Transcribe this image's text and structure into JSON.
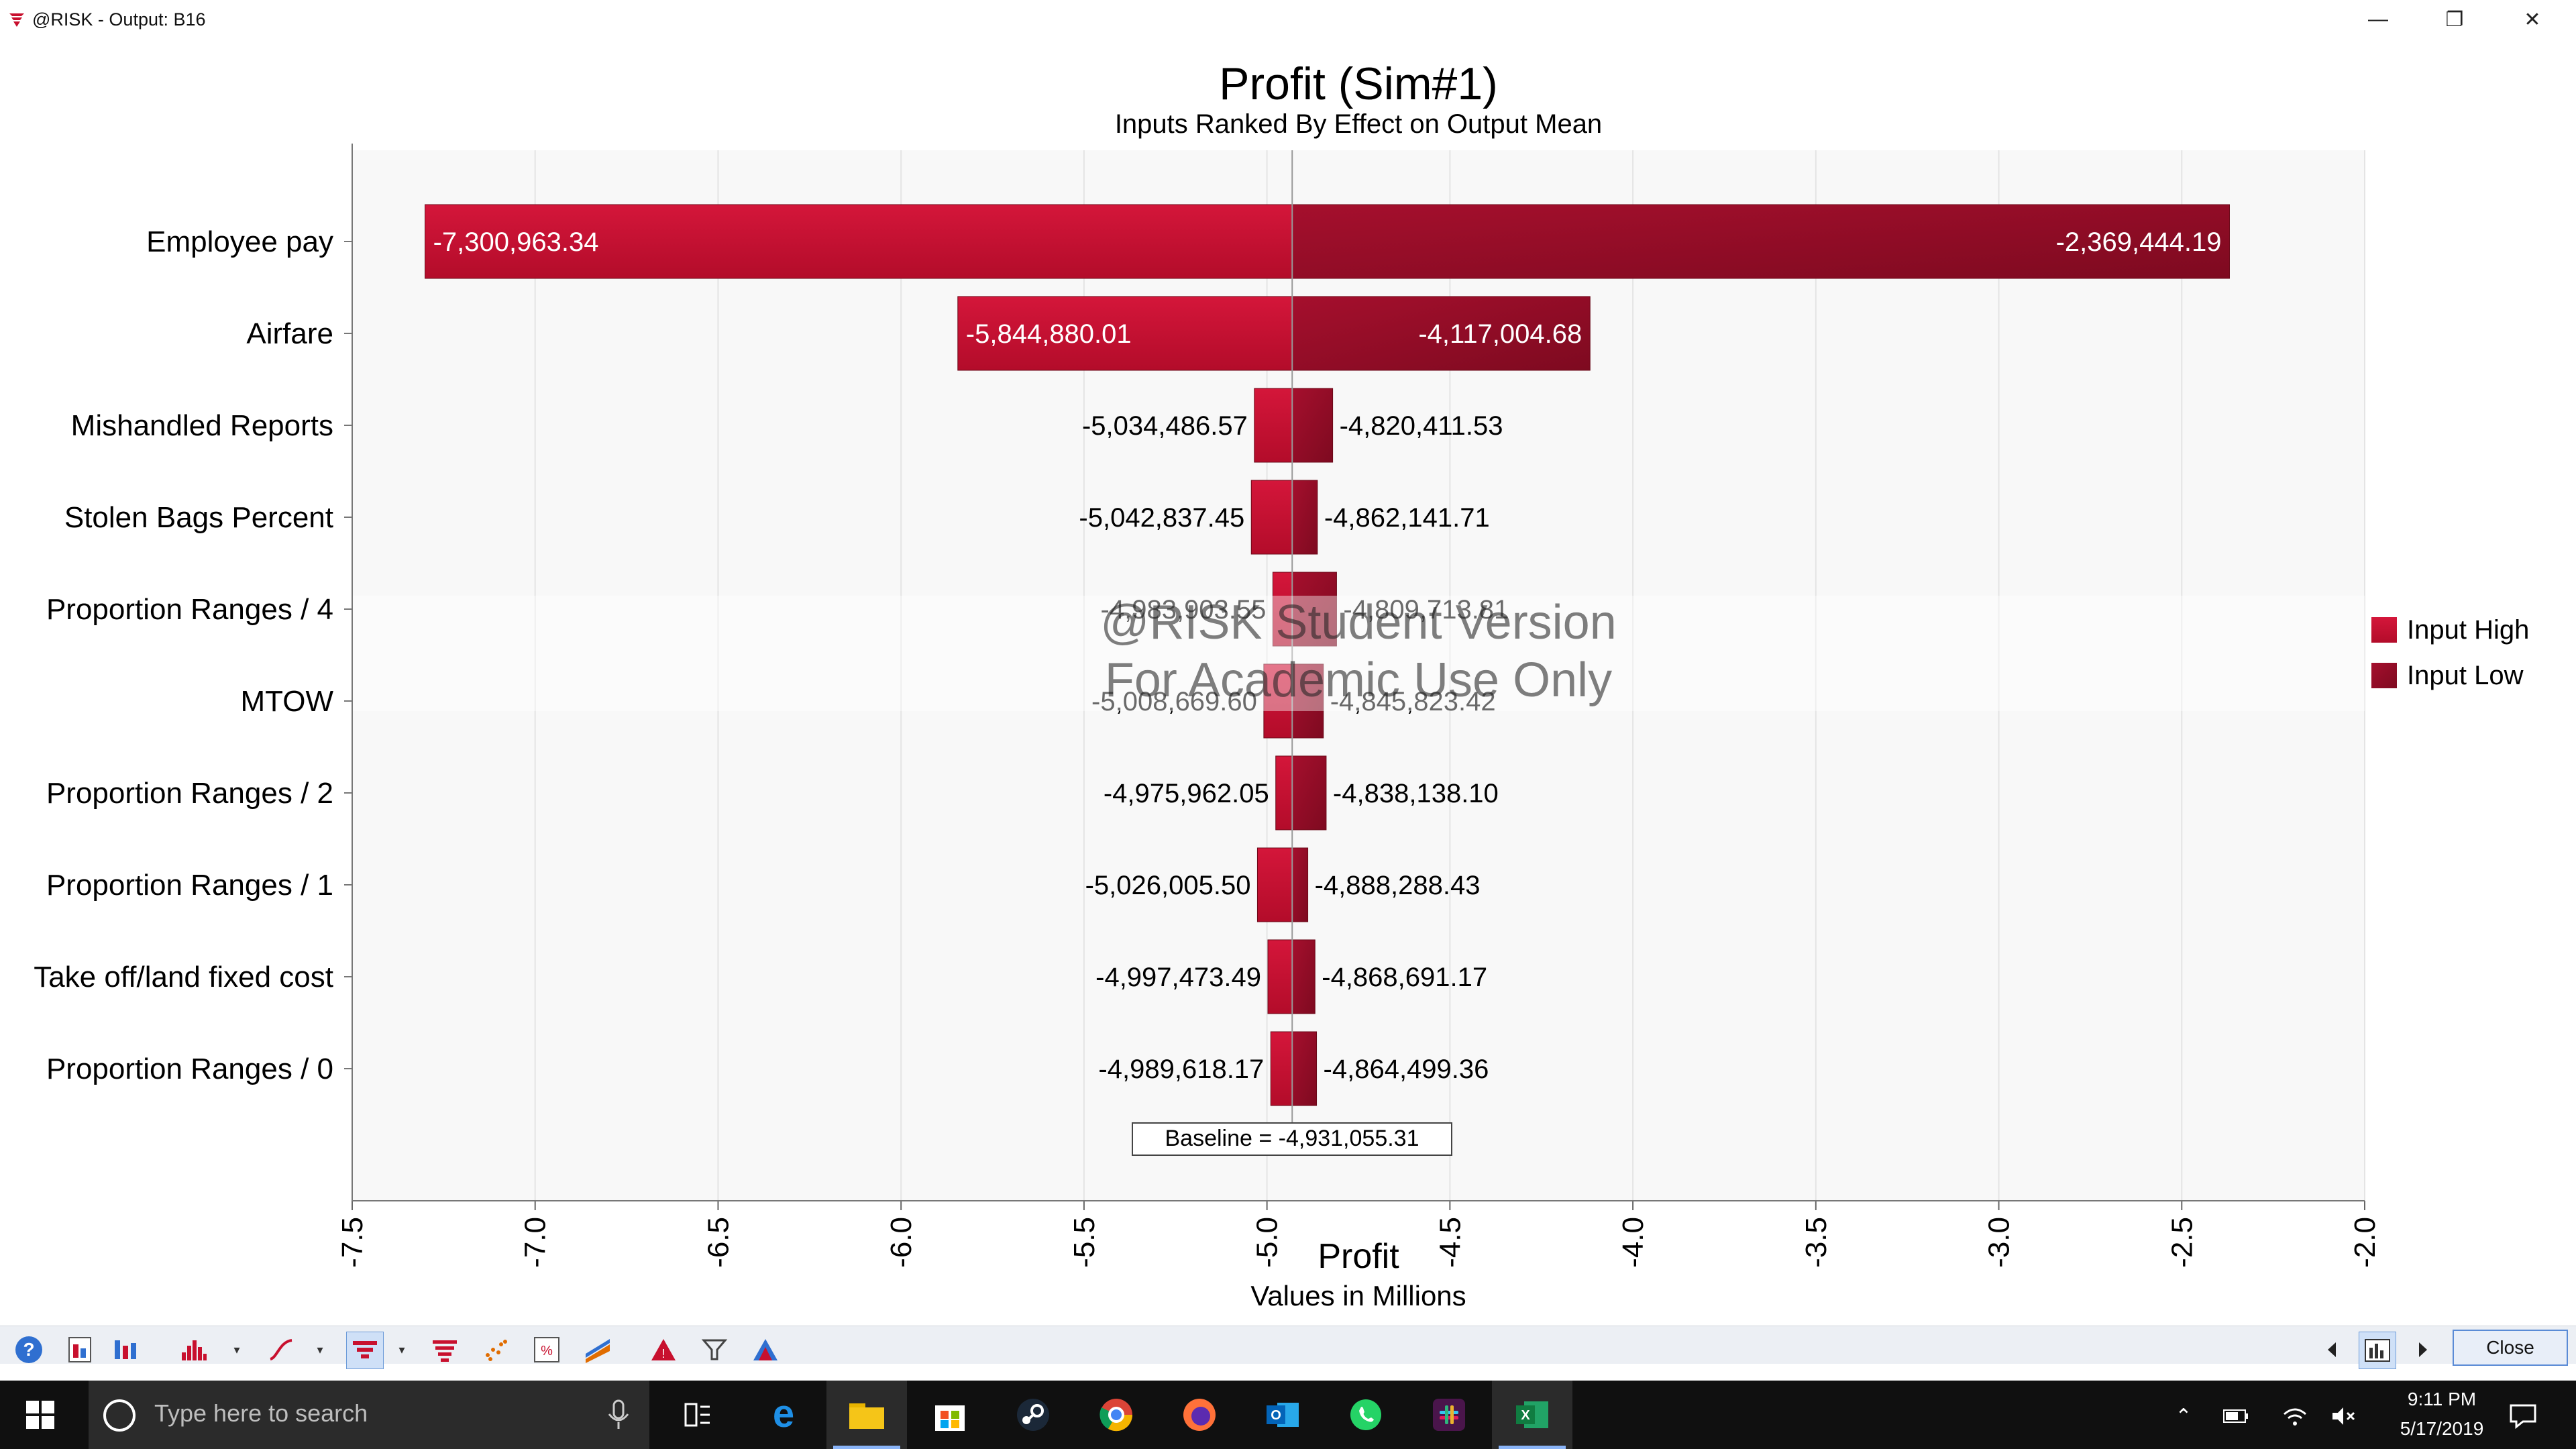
{
  "window": {
    "title": "@RISK - Output: B16",
    "min_glyph": "—",
    "max_glyph": "❐",
    "close_glyph": "✕"
  },
  "colors": {
    "bar_high": "#c8102e",
    "bar_low": "#8e0b24",
    "grid": "#e6e6e6",
    "plot_bg": "#f8f8f8"
  },
  "chart_data": {
    "type": "bar",
    "orientation": "horizontal-tornado",
    "title": "Profit (Sim#1)",
    "subtitle": "Inputs Ranked By Effect on Output Mean",
    "xlabel": "Profit",
    "xlabel_units": "Values in Millions",
    "xlim": [
      -7.5,
      -2.0
    ],
    "xticks": [
      "-7.5",
      "-7.0",
      "-6.5",
      "-6.0",
      "-5.5",
      "-5.0",
      "-4.5",
      "-4.0",
      "-3.5",
      "-3.0",
      "-2.5",
      "-2.0"
    ],
    "baseline_value": -4.93105531,
    "baseline_label": "Baseline = -4,931,055.31",
    "legend": [
      "Input High",
      "Input Low"
    ],
    "legend_position": "right",
    "grid": true,
    "bars": [
      {
        "label": "Employee pay",
        "low_value": -7.30096334,
        "high_value": -2.36944419,
        "low_label": "-7,300,963.34",
        "high_label": "-2,369,444.19"
      },
      {
        "label": "Airfare",
        "low_value": -5.84488001,
        "high_value": -4.11700468,
        "low_label": "-5,844,880.01",
        "high_label": "-4,117,004.68"
      },
      {
        "label": "Mishandled Reports",
        "low_value": -5.03448657,
        "high_value": -4.82041153,
        "low_label": "-5,034,486.57",
        "high_label": "-4,820,411.53"
      },
      {
        "label": "Stolen Bags Percent",
        "low_value": -5.04283745,
        "high_value": -4.86214171,
        "low_label": "-5,042,837.45",
        "high_label": "-4,862,141.71"
      },
      {
        "label": "Proportion Ranges / 4",
        "low_value": -4.98390355,
        "high_value": -4.80971381,
        "low_label": "-4,983,903.55",
        "high_label": "-4,809,713.81"
      },
      {
        "label": "MTOW",
        "low_value": -5.0086696,
        "high_value": -4.84582342,
        "low_label": "-5,008,669.60",
        "high_label": "-4,845,823.42"
      },
      {
        "label": "Proportion Ranges / 2",
        "low_value": -4.97596205,
        "high_value": -4.8381381,
        "low_label": "-4,975,962.05",
        "high_label": "-4,838,138.10"
      },
      {
        "label": "Proportion Ranges / 1",
        "low_value": -5.0260055,
        "high_value": -4.88828843,
        "low_label": "-5,026,005.50",
        "high_label": "-4,888,288.43"
      },
      {
        "label": "Take off/land fixed cost",
        "low_value": -4.99747349,
        "high_value": -4.86869117,
        "low_label": "-4,997,473.49",
        "high_label": "-4,868,691.17"
      },
      {
        "label": "Proportion Ranges / 0",
        "low_value": -4.98961817,
        "high_value": -4.86449936,
        "low_label": "-4,989,618.17",
        "high_label": "-4,864,499.36"
      }
    ],
    "watermark": [
      "@RISK Student Version",
      "For Academic Use Only"
    ]
  },
  "toolbar": {
    "close_label": "Close",
    "icons": [
      "help-icon",
      "report-icon",
      "chart-icon",
      "histogram-icon",
      "line-graph-icon",
      "tornado-icon",
      "spider-icon",
      "scatter-icon",
      "percentile-icon",
      "trend-icon",
      "warning-icon",
      "filter-icon",
      "mountain-icon"
    ]
  },
  "taskbar": {
    "search_placeholder": "Type here to search",
    "time": "9:11 PM",
    "date": "5/17/2019",
    "apps": [
      "edge",
      "file-explorer",
      "store",
      "steam",
      "chrome",
      "firefox",
      "outlook",
      "whatsapp",
      "slack",
      "excel"
    ]
  }
}
